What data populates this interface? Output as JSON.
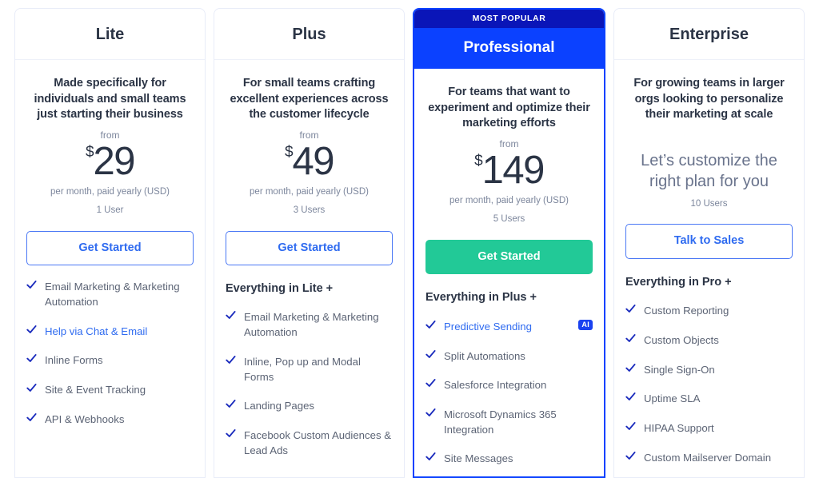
{
  "plans": [
    {
      "id": "lite",
      "name": "Lite",
      "featured": false,
      "badge": null,
      "tagline": "Made specifically for individuals and small teams just starting their business",
      "from_label": "from",
      "currency": "$",
      "price": "29",
      "price_note": "per month, paid yearly (USD)",
      "seats": "1 User",
      "custom_price": null,
      "cta_label": "Get Started",
      "cta_style": "outline",
      "includes_heading": null,
      "features": [
        {
          "text": "Email Marketing & Marketing Automation",
          "link": false,
          "badge": null
        },
        {
          "text": "Help via Chat & Email",
          "link": true,
          "badge": null
        },
        {
          "text": "Inline Forms",
          "link": false,
          "badge": null
        },
        {
          "text": "Site & Event Tracking",
          "link": false,
          "badge": null
        },
        {
          "text": "API & Webhooks",
          "link": false,
          "badge": null
        }
      ]
    },
    {
      "id": "plus",
      "name": "Plus",
      "featured": false,
      "badge": null,
      "tagline": "For small teams crafting excellent experiences across the customer lifecycle",
      "from_label": "from",
      "currency": "$",
      "price": "49",
      "price_note": "per month, paid yearly (USD)",
      "seats": "3 Users",
      "custom_price": null,
      "cta_label": "Get Started",
      "cta_style": "outline",
      "includes_heading": "Everything in Lite +",
      "features": [
        {
          "text": "Email Marketing & Marketing Automation",
          "link": false,
          "badge": null
        },
        {
          "text": "Inline, Pop up and Modal Forms",
          "link": false,
          "badge": null
        },
        {
          "text": "Landing Pages",
          "link": false,
          "badge": null
        },
        {
          "text": "Facebook Custom Audiences & Lead Ads",
          "link": false,
          "badge": null
        }
      ]
    },
    {
      "id": "professional",
      "name": "Professional",
      "featured": true,
      "badge": "MOST POPULAR",
      "tagline": "For teams that want to experiment and optimize their marketing efforts",
      "from_label": "from",
      "currency": "$",
      "price": "149",
      "price_note": "per month, paid yearly (USD)",
      "seats": "5 Users",
      "custom_price": null,
      "cta_label": "Get Started",
      "cta_style": "solid",
      "includes_heading": "Everything in Plus +",
      "features": [
        {
          "text": "Predictive Sending",
          "link": true,
          "badge": "AI"
        },
        {
          "text": "Split Automations",
          "link": false,
          "badge": null
        },
        {
          "text": "Salesforce Integration",
          "link": false,
          "badge": null
        },
        {
          "text": "Microsoft Dynamics 365 Integration",
          "link": false,
          "badge": null
        },
        {
          "text": "Site Messages",
          "link": false,
          "badge": null
        }
      ]
    },
    {
      "id": "enterprise",
      "name": "Enterprise",
      "featured": false,
      "badge": null,
      "tagline": "For growing teams in larger orgs looking to personalize their marketing at scale",
      "from_label": null,
      "currency": null,
      "price": null,
      "price_note": null,
      "seats": "10 Users",
      "custom_price": "Let’s customize the right plan for you",
      "cta_label": "Talk to Sales",
      "cta_style": "outline",
      "includes_heading": "Everything in Pro +",
      "features": [
        {
          "text": "Custom Reporting",
          "link": false,
          "badge": null
        },
        {
          "text": "Custom Objects",
          "link": false,
          "badge": null
        },
        {
          "text": "Single Sign-On",
          "link": false,
          "badge": null
        },
        {
          "text": "Uptime SLA",
          "link": false,
          "badge": null
        },
        {
          "text": "HIPAA Support",
          "link": false,
          "badge": null
        },
        {
          "text": "Custom Mailserver Domain",
          "link": false,
          "badge": null
        }
      ]
    }
  ],
  "colors": {
    "featured_header": "#0b41ff",
    "badge_banner": "#0a15b8",
    "cta_solid": "#22c997",
    "cta_outline_text": "#2f6bf0",
    "check": "#1a2bbd",
    "link": "#2f6bf0",
    "ai_badge": "#1a42f0",
    "title": "#2b3445",
    "muted": "#7c869c"
  },
  "icons": {
    "check": "check-icon"
  }
}
